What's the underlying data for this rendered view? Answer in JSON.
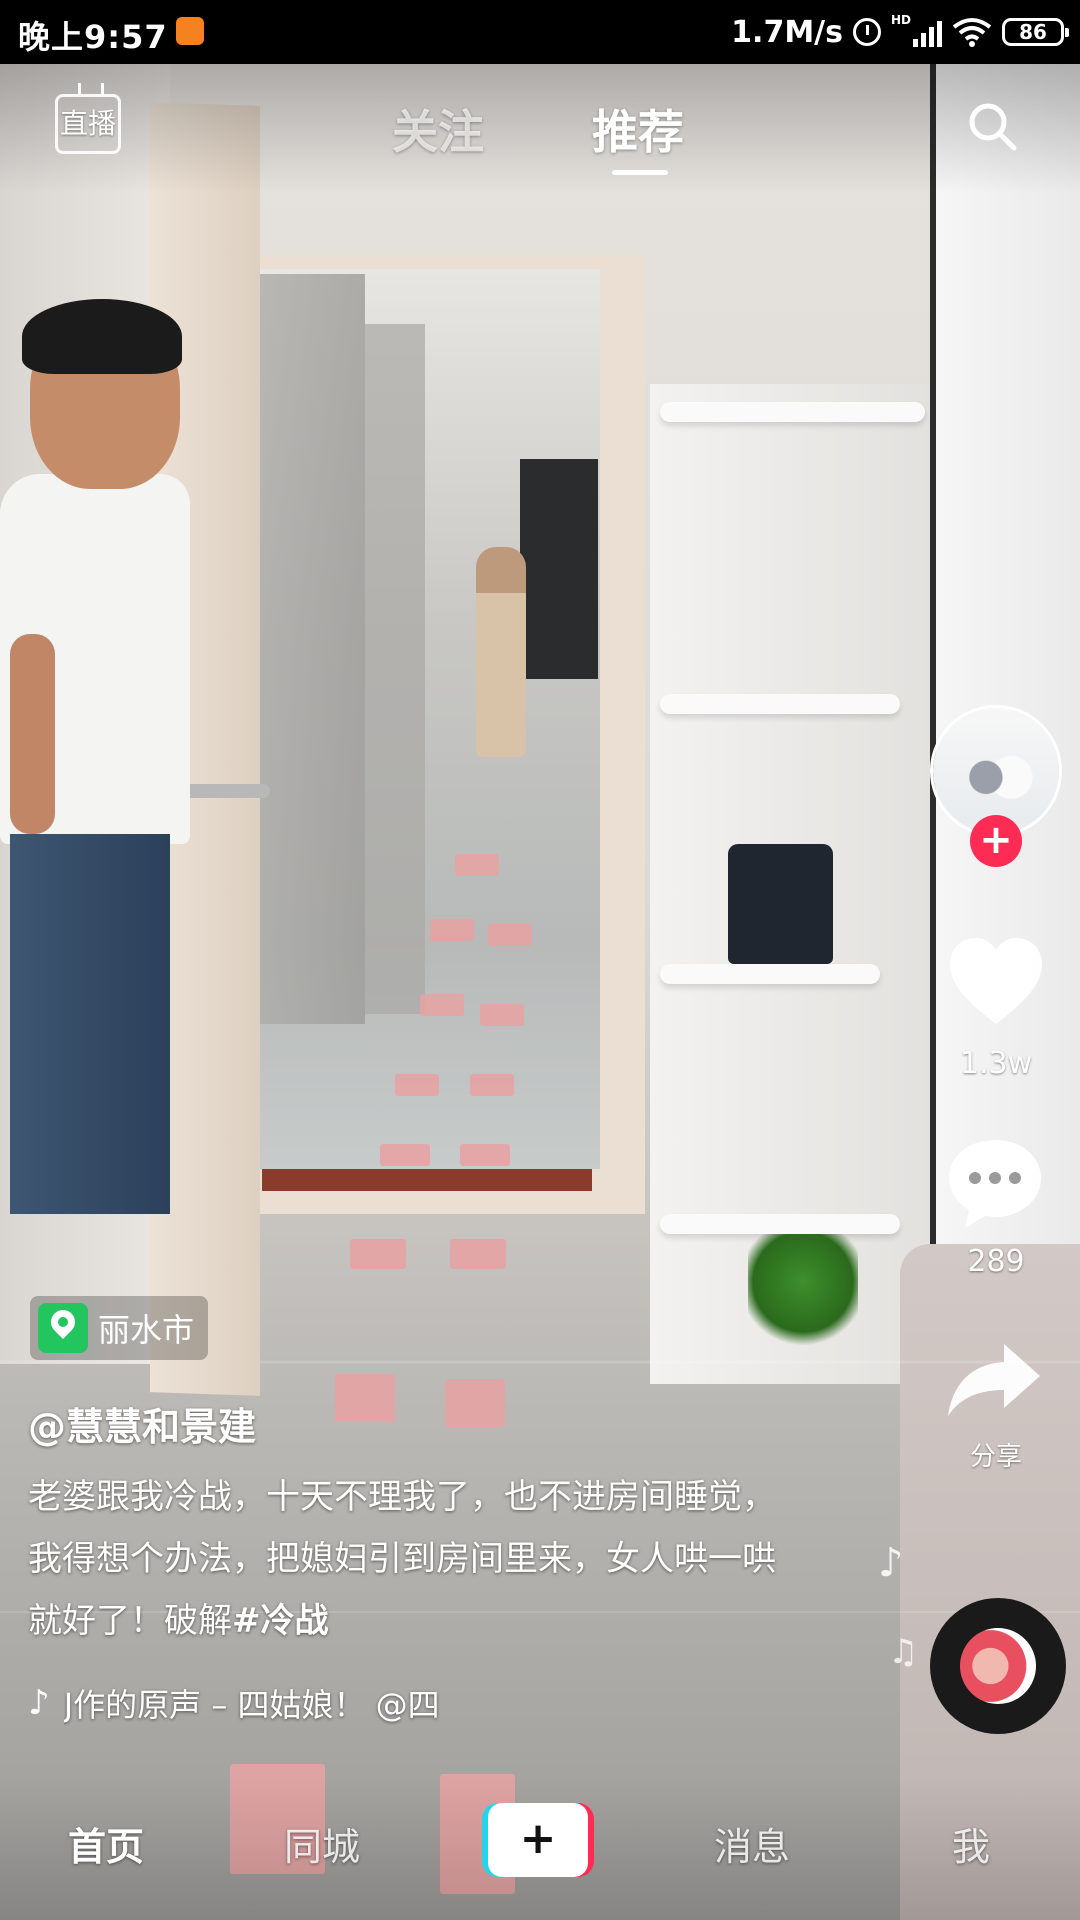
{
  "status_bar": {
    "time": "晚上9:57",
    "speed": "1.7M/s",
    "network": "HD",
    "battery": "86"
  },
  "top_nav": {
    "live_label": "直播",
    "tabs": [
      {
        "label": "关注",
        "active": false
      },
      {
        "label": "推荐",
        "active": true
      }
    ],
    "search_icon": "search-icon"
  },
  "side_actions": {
    "avatar_icon": "avatar",
    "follow_icon": "plus-icon",
    "like_count": "1.3w",
    "comment_count": "289",
    "share_label": "分享"
  },
  "video_info": {
    "location": "丽水市",
    "username": "@慧慧和景建",
    "caption": "老婆跟我冷战，十天不理我了，也不进房间睡觉，我得想个办法，把媳妇引到房间里来，女人哄一哄就好了！破解",
    "hashtag": "#冷战",
    "music": "J作的原声 – 四姑娘！   @四"
  },
  "bottom_nav": {
    "items": [
      {
        "label": "首页",
        "active": true
      },
      {
        "label": "同城",
        "active": false
      },
      {
        "label": "",
        "icon": "plus-icon"
      },
      {
        "label": "消息",
        "active": false
      },
      {
        "label": "我",
        "active": false
      }
    ],
    "plus_label": "+"
  },
  "colors": {
    "accent_red": "#fe2c55",
    "accent_cyan": "#20d5ec",
    "location_green": "#22c55e"
  }
}
